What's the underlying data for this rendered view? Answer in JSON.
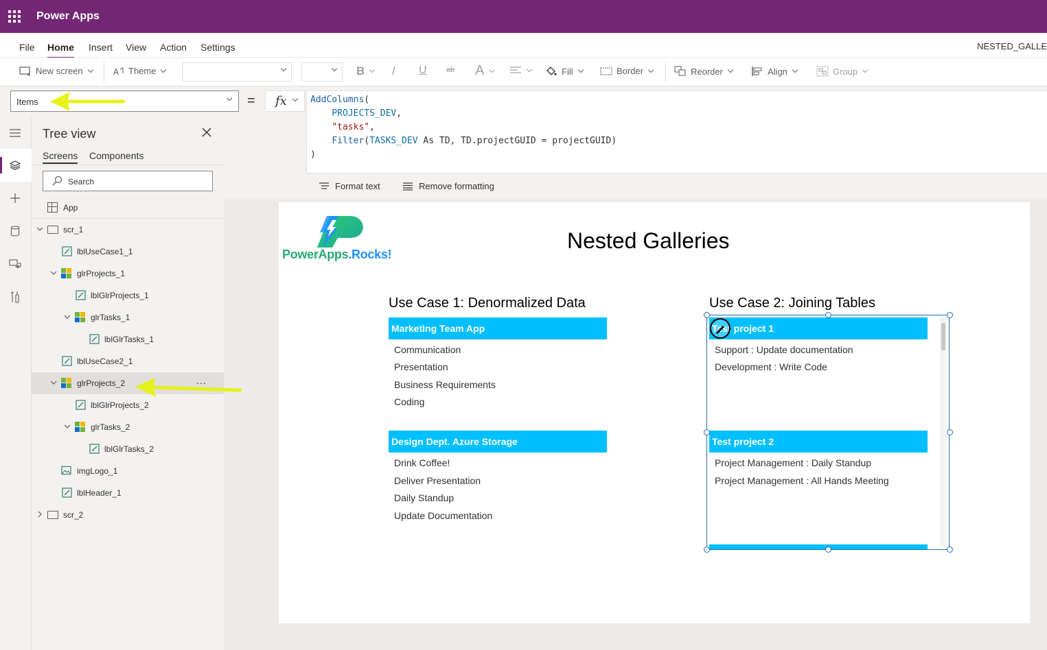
{
  "app": {
    "title": "Power Apps",
    "document_name": "NESTED_GALLE"
  },
  "menu": {
    "items": [
      "File",
      "Home",
      "Insert",
      "View",
      "Action",
      "Settings"
    ],
    "active": "Home"
  },
  "ribbon": {
    "new_screen": "New screen",
    "theme": "Theme",
    "bold": "B",
    "italic": "/",
    "underline": "U",
    "strike": "ab",
    "font_size_glyph": "A",
    "fill": "Fill",
    "border": "Border",
    "reorder": "Reorder",
    "align": "Align",
    "group": "Group"
  },
  "formula_bar": {
    "property": "Items",
    "equals": "=",
    "fx": "fx",
    "tools": {
      "format_text": "Format text",
      "remove_formatting": "Remove formatting"
    }
  },
  "tree_view": {
    "title": "Tree view",
    "tabs": [
      "Screens",
      "Components"
    ],
    "active_tab": "Screens",
    "search_placeholder": "Search",
    "app_item": "App",
    "nodes": [
      "scr_1",
      "lblUseCase1_1",
      "glrProjects_1",
      "lblGlrProjects_1",
      "glrTasks_1",
      "lblGlrTasks_1",
      "lblUseCase2_1",
      "glrProjects_2",
      "lblGlrProjects_2",
      "glrTasks_2",
      "lblGlrTasks_2",
      "imgLogo_1",
      "lblHeader_1",
      "scr_2"
    ],
    "selected": "glrProjects_2",
    "more_label": "..."
  },
  "canvas": {
    "logo": {
      "text_main": "PowerApps",
      "text_accent": ".Rocks!"
    },
    "header": "Nested Galleries",
    "use_case_1": {
      "title": "Use Case 1: Denormalized Data",
      "projects": [
        {
          "name": "Marketing Team App",
          "tasks": [
            "Communication",
            "Presentation",
            "Business Requirements",
            "Coding"
          ]
        },
        {
          "name": "Design Dept. Azure Storage",
          "tasks": [
            "Drink Coffee!",
            "Deliver Presentation",
            "Daily Standup",
            "Update Documentation"
          ]
        }
      ]
    },
    "use_case_2": {
      "title": "Use Case 2: Joining Tables",
      "projects": [
        {
          "name": "Test project 1",
          "tasks": [
            "Support : Update documentation",
            "Development : Write Code"
          ]
        },
        {
          "name": "Test project 2",
          "tasks": [
            "Project Management : Daily Standup",
            "Project Management : All Hands Meeting"
          ]
        }
      ]
    }
  },
  "colors": {
    "brand": "#742774",
    "gallery_header": "#00bfff",
    "selection": "#1f6fb2",
    "annotation_arrow": "#e6f21a"
  }
}
